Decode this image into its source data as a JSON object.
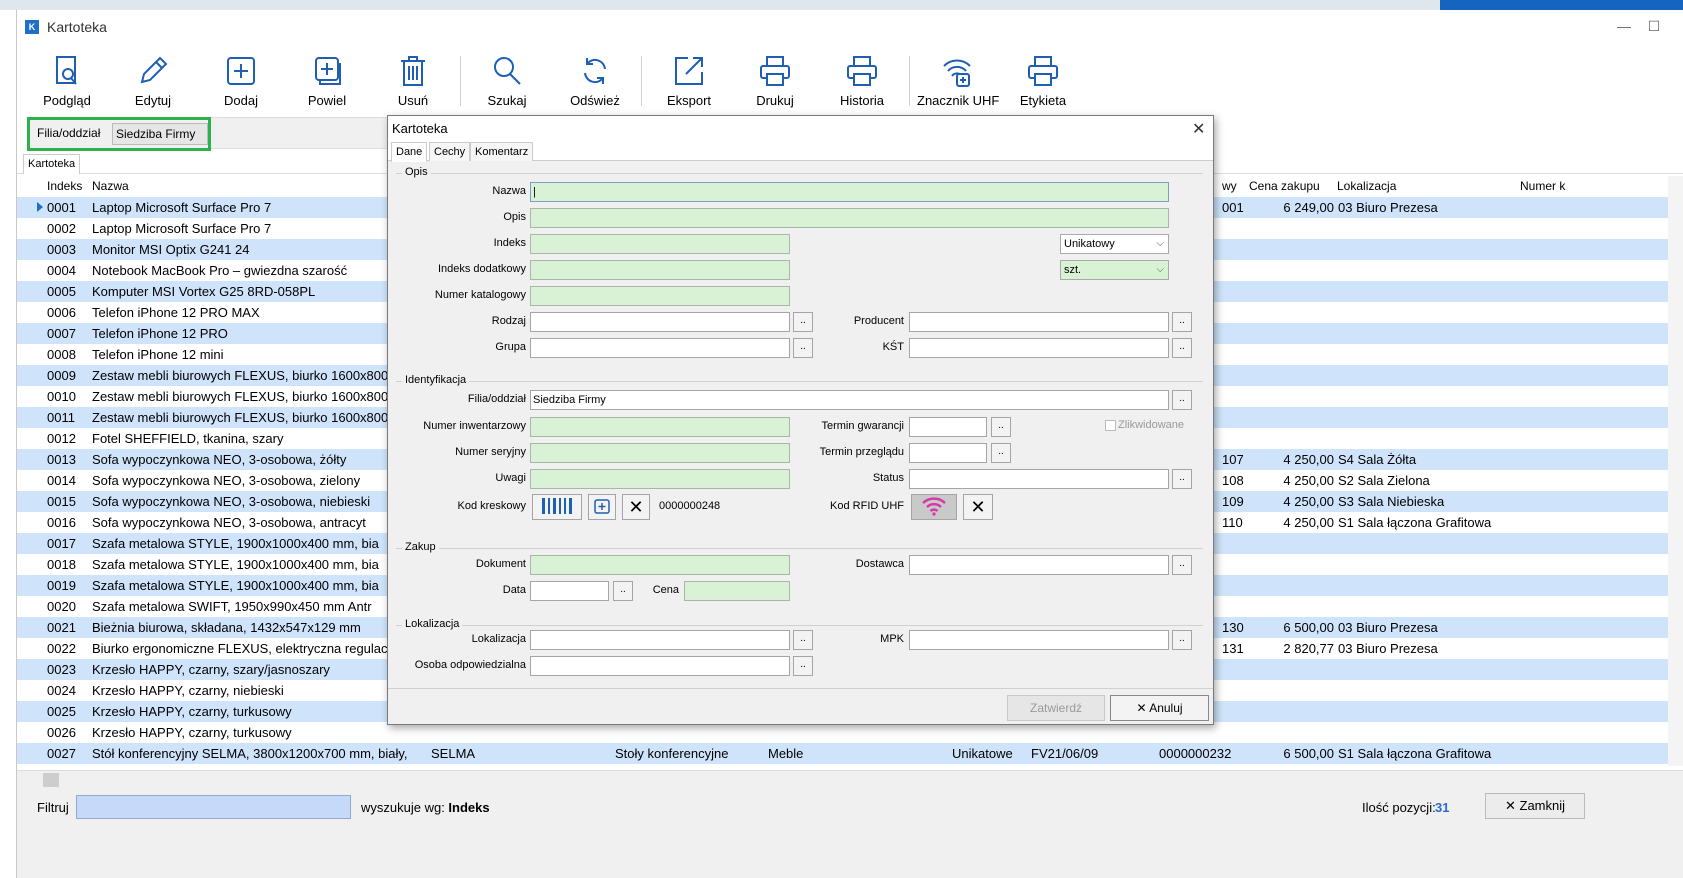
{
  "window": {
    "title": "Kartoteka",
    "minimize": "—",
    "maximize": "☐",
    "close": "✕"
  },
  "toolbar": [
    {
      "label": "Podgląd",
      "icon": "preview-icon"
    },
    {
      "label": "Edytuj",
      "icon": "pencil-icon"
    },
    {
      "label": "Dodaj",
      "icon": "plus-icon"
    },
    {
      "label": "Powiel",
      "icon": "duplicate-icon"
    },
    {
      "label": "Usuń",
      "icon": "trash-icon"
    },
    {
      "label": "Szukaj",
      "icon": "search-icon"
    },
    {
      "label": "Odśwież",
      "icon": "refresh-icon"
    },
    {
      "label": "Eksport",
      "icon": "export-icon"
    },
    {
      "label": "Drukuj",
      "icon": "printer-icon"
    },
    {
      "label": "Historia",
      "icon": "printer-icon"
    },
    {
      "label": "Znacznik UHF",
      "icon": "rfid-icon"
    },
    {
      "label": "Etykieta",
      "icon": "printer-icon"
    }
  ],
  "filter_bar": {
    "label": "Filia/oddział",
    "value": "Siedziba Firmy"
  },
  "tab": "Kartoteka",
  "grid": {
    "headers": {
      "index": "Indeks",
      "name": "Nazwa",
      "col_wy": "wy",
      "price": "Cena zakupu",
      "location": "Lokalizacja",
      "number": "Numer k"
    },
    "rows": [
      {
        "index": "0001",
        "name": "Laptop Microsoft Surface Pro 7",
        "col_wy": "001",
        "price": "6 249,00",
        "location": "03 Biuro Prezesa"
      },
      {
        "index": "0002",
        "name": "Laptop Microsoft Surface Pro 7",
        "col_wy": "",
        "price": "",
        "location": ""
      },
      {
        "index": "0003",
        "name": "Monitor MSI Optix G241 24",
        "col_wy": "",
        "price": "",
        "location": ""
      },
      {
        "index": "0004",
        "name": "Notebook MacBook Pro – gwiezdna szarość",
        "col_wy": "",
        "price": "",
        "location": ""
      },
      {
        "index": "0005",
        "name": "Komputer MSI Vortex G25 8RD-058PL",
        "col_wy": "",
        "price": "",
        "location": ""
      },
      {
        "index": "0006",
        "name": "Telefon iPhone 12 PRO MAX",
        "col_wy": "",
        "price": "",
        "location": ""
      },
      {
        "index": "0007",
        "name": "Telefon iPhone 12 PRO",
        "col_wy": "",
        "price": "",
        "location": ""
      },
      {
        "index": "0008",
        "name": "Telefon iPhone 12 mini",
        "col_wy": "",
        "price": "",
        "location": ""
      },
      {
        "index": "0009",
        "name": "Zestaw mebli biurowych FLEXUS, biurko 1600x800",
        "col_wy": "",
        "price": "",
        "location": ""
      },
      {
        "index": "0010",
        "name": "Zestaw mebli biurowych FLEXUS, biurko 1600x800",
        "col_wy": "",
        "price": "",
        "location": ""
      },
      {
        "index": "0011",
        "name": "Zestaw mebli biurowych FLEXUS, biurko 1600x800",
        "col_wy": "",
        "price": "",
        "location": ""
      },
      {
        "index": "0012",
        "name": "Fotel SHEFFIELD, tkanina, szary",
        "col_wy": "",
        "price": "",
        "location": ""
      },
      {
        "index": "0013",
        "name": "Sofa wypoczynkowa NEO, 3-osobowa, żółty",
        "col_wy": "107",
        "price": "4 250,00",
        "location": "S4 Sala Żółta"
      },
      {
        "index": "0014",
        "name": "Sofa wypoczynkowa NEO, 3-osobowa, zielony",
        "col_wy": "108",
        "price": "4 250,00",
        "location": "S2 Sala Zielona"
      },
      {
        "index": "0015",
        "name": "Sofa wypoczynkowa NEO, 3-osobowa, niebieski",
        "col_wy": "109",
        "price": "4 250,00",
        "location": "S3 Sala Niebieska"
      },
      {
        "index": "0016",
        "name": "Sofa wypoczynkowa NEO, 3-osobowa, antracyt",
        "col_wy": "110",
        "price": "4 250,00",
        "location": "S1 Sala łączona Grafitowa"
      },
      {
        "index": "0017",
        "name": "Szafa metalowa STYLE, 1900x1000x400 mm, bia",
        "col_wy": "",
        "price": "",
        "location": ""
      },
      {
        "index": "0018",
        "name": "Szafa metalowa STYLE, 1900x1000x400 mm, bia",
        "col_wy": "",
        "price": "",
        "location": ""
      },
      {
        "index": "0019",
        "name": "Szafa metalowa STYLE, 1900x1000x400 mm, bia",
        "col_wy": "",
        "price": "",
        "location": ""
      },
      {
        "index": "0020",
        "name": "Szafa metalowa SWIFT, 1950x990x450 mm Antr",
        "col_wy": "",
        "price": "",
        "location": ""
      },
      {
        "index": "0021",
        "name": "Bieżnia biurowa, składana, 1432x547x129 mm",
        "col_wy": "130",
        "price": "6 500,00",
        "location": "03 Biuro Prezesa"
      },
      {
        "index": "0022",
        "name": "Biurko ergonomiczne FLEXUS, elektryczna regulac",
        "col_wy": "131",
        "price": "2 820,77",
        "location": "03 Biuro Prezesa"
      },
      {
        "index": "0023",
        "name": "Krzesło HAPPY, czarny, szary/jasnoszary",
        "col_wy": "",
        "price": "",
        "location": ""
      },
      {
        "index": "0024",
        "name": "Krzesło HAPPY, czarny, niebieski",
        "col_wy": "",
        "price": "",
        "location": ""
      },
      {
        "index": "0025",
        "name": "Krzesło HAPPY, czarny, turkusowy",
        "col_wy": "",
        "price": "",
        "location": ""
      },
      {
        "index": "0026",
        "name": "Krzesło HAPPY, czarny, turkusowy",
        "col_wy": "",
        "price": "",
        "location": ""
      }
    ],
    "last_row": {
      "index": "0027",
      "name": "Stół konferencyjny SELMA, 3800x1200x700 mm, biały,",
      "producer": "SELMA",
      "kind": "Stoły konferencyjne",
      "group": "Meble",
      "type": "Unikatowe",
      "inventory": "FV21/06/09",
      "barcode": "0000000232",
      "price": "6 500,00",
      "location": "S1 Sala łączona Grafitowa"
    }
  },
  "status": {
    "filter_label": "Filtruj",
    "search_prefix": "wyszukuje wg: ",
    "search_field": "Indeks",
    "count_label": "Ilość pozycji:",
    "count": "31",
    "close_label": "Zamknij"
  },
  "dialog": {
    "title": "Kartoteka",
    "tabs": [
      "Dane",
      "Cechy",
      "Komentarz"
    ],
    "groups": {
      "opis": "Opis",
      "identyfikacja": "Identyfikacja",
      "zakup": "Zakup",
      "lokalizacja": "Lokalizacja"
    },
    "labels": {
      "nazwa": "Nazwa",
      "opis": "Opis",
      "indeks": "Indeks",
      "indeks_dod": "Indeks dodatkowy",
      "numer_kat": "Numer katalogowy",
      "rodzaj": "Rodzaj",
      "grupa": "Grupa",
      "producent": "Producent",
      "kst": "KŚT",
      "filia": "Filia/oddział",
      "numer_inw": "Numer inwentarzowy",
      "numer_ser": "Numer seryjny",
      "uwagi": "Uwagi",
      "kod_kreskowy": "Kod kreskowy",
      "termin_gw": "Termin gwarancji",
      "termin_prz": "Termin przeglądu",
      "status": "Status",
      "kod_rfid": "Kod RFID UHF",
      "zlikwidowane": "Zlikwidowane",
      "dokument": "Dokument",
      "data": "Data",
      "cena": "Cena",
      "dostawca": "Dostawca",
      "lokalizacja": "Lokalizacja",
      "mpk": "MPK",
      "osoba": "Osoba odpowiedzialna"
    },
    "values": {
      "filia": "Siedziba Firmy",
      "barcode": "0000000248",
      "typ": "Unikatowy",
      "jednostka": "szt."
    },
    "buttons": {
      "ok": "Zatwierdź",
      "cancel": "Anuluj"
    }
  }
}
